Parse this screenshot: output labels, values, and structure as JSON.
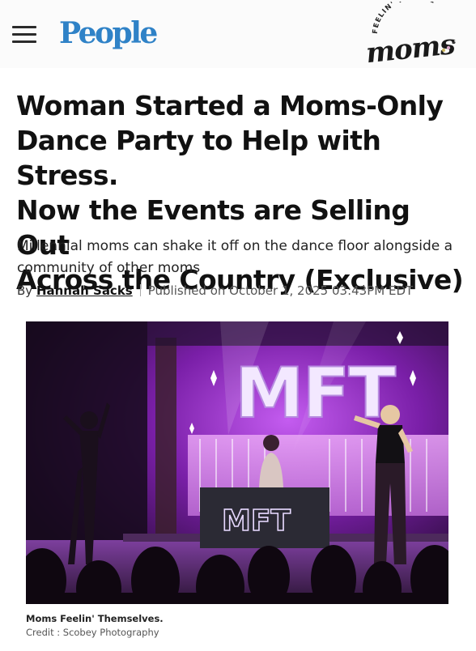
{
  "header": {
    "logo_text": "People",
    "partner_logo": {
      "arc_text": "FEELIN' THEMSE",
      "arc_suffix": "S",
      "wordmark": "moms",
      "dot": "."
    }
  },
  "article": {
    "headline_lines": [
      "Woman Started a Moms-Only",
      "Dance Party to Help with Stress.",
      "Now the Events are Selling Out",
      "Across the Country (Exclusive)"
    ],
    "subhead_lines": [
      "Millennial moms can shake it off on the dance floor alongside a",
      "community of other moms"
    ],
    "byline": {
      "prefix": "By",
      "author": "Hannah Sacks",
      "published": "Published on October 1, 2025 03:43PM EDT"
    }
  },
  "photo": {
    "sign_text": "MFT",
    "booth_text": "MFT",
    "caption": "Moms Feelin' Themselves.",
    "credit": "Credit : Scobey Photography"
  },
  "colors": {
    "people_blue": "#2f82c7",
    "stage_purple": "#8a2bb8",
    "neon": "#efe2ff"
  },
  "icons": [
    "hamburger-menu-icon"
  ]
}
